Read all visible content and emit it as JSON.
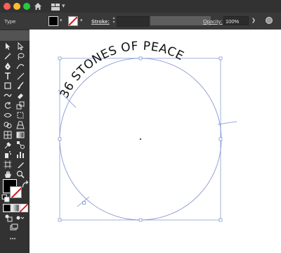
{
  "titlebar": {
    "home_icon": "home-icon",
    "workspace_icon": "workspace-switcher-icon"
  },
  "control_bar": {
    "mode_label": "Type",
    "fill_color": "#000000",
    "stroke_swatch": "none",
    "stroke_label": "Stroke:",
    "stroke_weight": "",
    "opacity_label": "Opacity:",
    "opacity_value": "100%",
    "chevron": "❯"
  },
  "toolbar": {
    "tools": [
      "selection-tool-icon",
      "direct-selection-tool-icon",
      "magic-wand-tool-icon",
      "lasso-tool-icon",
      "pen-tool-icon",
      "curvature-tool-icon",
      "type-tool-icon",
      "line-tool-icon",
      "rectangle-tool-icon",
      "paintbrush-tool-icon",
      "shaper-tool-icon",
      "eraser-tool-icon",
      "rotate-tool-icon",
      "scale-tool-icon",
      "width-tool-icon",
      "free-transform-tool-icon",
      "shape-builder-tool-icon",
      "perspective-grid-tool-icon",
      "mesh-tool-icon",
      "gradient-tool-icon",
      "eyedropper-tool-icon",
      "blend-tool-icon",
      "symbol-sprayer-tool-icon",
      "column-graph-tool-icon",
      "artboard-tool-icon",
      "slice-tool-icon",
      "hand-tool-icon",
      "zoom-tool-icon"
    ],
    "more_label": "•••",
    "fill_color": "#000000"
  },
  "canvas": {
    "path_text": "36 STONES OF PEACE",
    "path_color": "#7b8fcf"
  }
}
